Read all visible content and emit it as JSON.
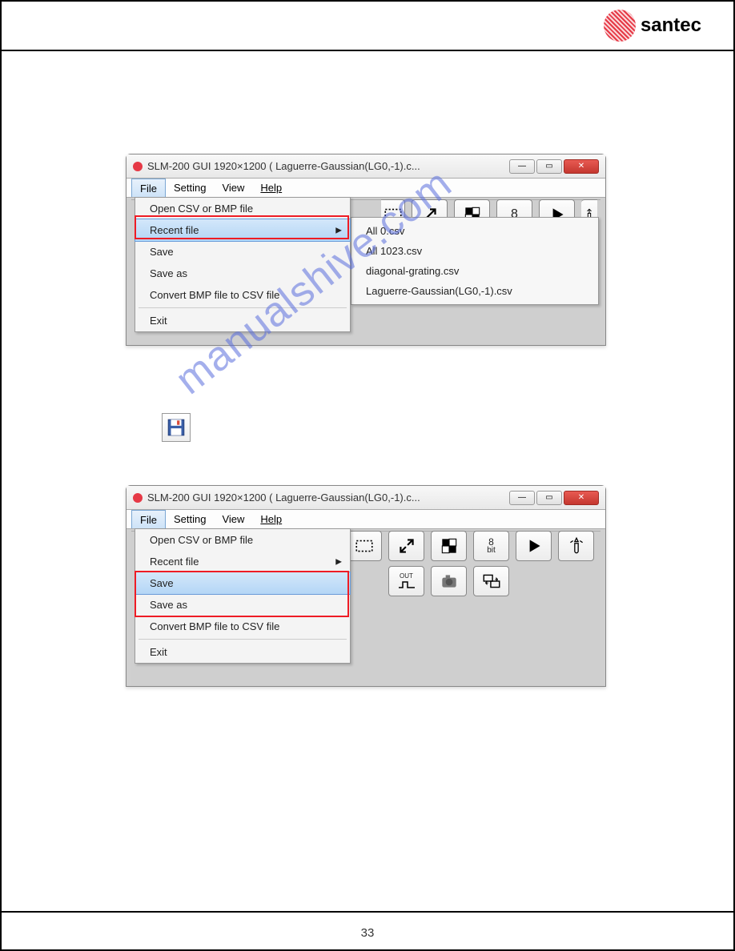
{
  "logo_text": "santec",
  "watermark": "manualshive.com",
  "page_number": "33",
  "window1": {
    "title": "SLM-200 GUI 1920×1200  ( Laguerre-Gaussian(LG0,-1).c...",
    "menu": {
      "file": "File",
      "setting": "Setting",
      "view": "View",
      "help": "Help"
    },
    "dropdown": {
      "open": "Open CSV or BMP file",
      "recent": "Recent file",
      "save": "Save",
      "saveas": "Save as",
      "convert": "Convert BMP file to CSV file",
      "exit": "Exit"
    },
    "submenu": {
      "f1": "All 0.csv",
      "f2": "All 1023.csv",
      "f3": "diagonal-grating.csv",
      "f4": "Laguerre-Gaussian(LG0,-1).csv"
    },
    "toolbar_8": "8"
  },
  "window2": {
    "title": "SLM-200 GUI 1920×1200  ( Laguerre-Gaussian(LG0,-1).c...",
    "menu": {
      "file": "File",
      "setting": "Setting",
      "view": "View",
      "help": "Help"
    },
    "dropdown": {
      "open": "Open CSV or BMP file",
      "recent": "Recent file",
      "save": "Save",
      "saveas": "Save as",
      "convert": "Convert BMP file to CSV file",
      "exit": "Exit"
    },
    "toolbar_8bit": "8\nbit",
    "toolbar_out": "OUT"
  }
}
